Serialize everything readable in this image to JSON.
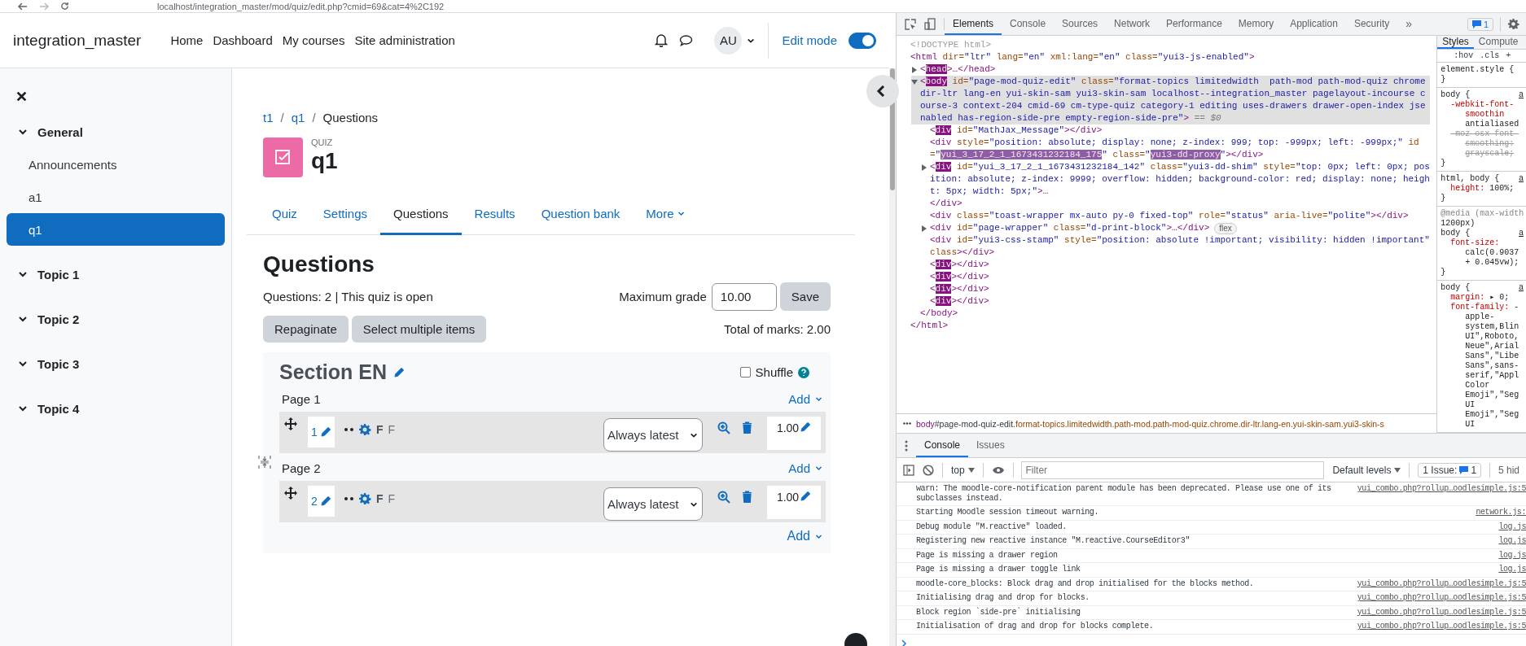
{
  "browser": {
    "url": "localhost/integration_master/mod/quiz/edit.php?cmid=69&cat=4%2C192"
  },
  "header": {
    "site_name": "integration_master",
    "nav": [
      "Home",
      "Dashboard",
      "My courses",
      "Site administration"
    ],
    "avatar": "AU",
    "edit_mode": {
      "label": "Edit mode",
      "on": true
    }
  },
  "drawer": {
    "sections": [
      {
        "title": "General",
        "expanded": true,
        "items": [
          {
            "label": "Announcements",
            "selected": false
          },
          {
            "label": "a1",
            "selected": false
          },
          {
            "label": "q1",
            "selected": true
          }
        ]
      },
      {
        "title": "Topic 1",
        "expanded": true
      },
      {
        "title": "Topic 2",
        "expanded": true
      },
      {
        "title": "Topic 3",
        "expanded": true
      },
      {
        "title": "Topic 4",
        "expanded": true
      }
    ]
  },
  "breadcrumb": [
    {
      "label": "t1",
      "kind": "link"
    },
    {
      "separator": "/",
      "label": "q1",
      "kind": "link"
    },
    {
      "separator": "/",
      "label": "Questions",
      "kind": "current"
    }
  ],
  "activity": {
    "type": "QUIZ",
    "name": "q1"
  },
  "tabs": [
    {
      "label": "Quiz",
      "selected": false,
      "kind": "link"
    },
    {
      "label": "Settings",
      "selected": false,
      "kind": "link"
    },
    {
      "label": "Questions",
      "selected": true,
      "kind": "link"
    },
    {
      "label": "Results",
      "selected": false,
      "kind": "link"
    },
    {
      "label": "Question bank",
      "selected": false,
      "kind": "link"
    },
    {
      "label": "More",
      "selected": false,
      "kind": "dropdown"
    }
  ],
  "page_title": "Questions",
  "quiz_info": "Questions: 2 | This quiz is open",
  "max_grade": {
    "label": "Maximum grade",
    "value": "10.00",
    "button": "Save"
  },
  "actions": [
    "Repaginate",
    "Select multiple items"
  ],
  "total_marks": "Total of marks: 2.00",
  "section": {
    "title": "Section EN",
    "shuffle": {
      "label": "Shuffle",
      "checked": false
    },
    "pages": [
      {
        "title": "Page 1",
        "add": "Add",
        "slots": [
          {
            "number": "1",
            "type_label": "F",
            "name": "F",
            "version": "Always latest",
            "mark": "1.00"
          }
        ]
      },
      {
        "title": "Page 2",
        "add": "Add",
        "slots": [
          {
            "number": "2",
            "type_label": "F",
            "name": "F",
            "version": "Always latest",
            "mark": "1.00"
          }
        ]
      }
    ],
    "add": "Add"
  },
  "devtools": {
    "tabs": [
      {
        "label": "Elements",
        "selected": true
      },
      {
        "label": "Console",
        "selected": false
      },
      {
        "label": "Sources",
        "selected": false
      },
      {
        "label": "Network",
        "selected": false
      },
      {
        "label": "Performance",
        "selected": false
      },
      {
        "label": "Memory",
        "selected": false
      },
      {
        "label": "Application",
        "selected": false
      },
      {
        "label": "Security",
        "selected": false
      }
    ],
    "more_tabs": "»",
    "issues_badge": "1",
    "elements": [
      {
        "open": [
          {
            "kind": "comment",
            "text": "<!DOCTYPE html>"
          }
        ]
      },
      {
        "open": [
          {
            "kind": "tag",
            "text": "<html"
          },
          {
            "kind": "attr",
            "text": " dir="
          },
          {
            "kind": "value",
            "text": "\"ltr\""
          },
          {
            "kind": "attr",
            "text": " lang="
          },
          {
            "kind": "value",
            "text": "\"en\""
          },
          {
            "kind": "attr",
            "text": " xml:lang="
          },
          {
            "kind": "value",
            "text": "\"en\""
          },
          {
            "kind": "attr",
            "text": " class="
          },
          {
            "kind": "value",
            "text": "\"yui3-js-enabled\""
          },
          {
            "kind": "tag",
            "text": ">"
          }
        ],
        "children": [
          {
            "open": [
              {
                "kind": "tag",
                "text": "<"
              },
              {
                "kind": "hl_tag",
                "text": "head"
              },
              {
                "kind": "tag",
                "text": ">…</head>"
              }
            ],
            "expanded": false
          },
          {
            "open": [
              {
                "kind": "tag",
                "text": "<"
              },
              {
                "kind": "hl_tag",
                "text": "body"
              },
              {
                "kind": "attr",
                "text": " id="
              },
              {
                "kind": "value",
                "text": "\"page-mod-quiz-edit\""
              },
              {
                "kind": "attr",
                "text": " class="
              },
              {
                "kind": "value",
                "text": "\"format-topics limitedwidth  path-mod path-mod-quiz chrome dir-ltr lang-en yui-skin-sam yui3-skin-sam localhost--integration_master pagelayout-incourse course-3 context-204 cmid-69 cm-type-quiz category-1 editing uses-drawers drawer-open-index jsenabled has-region-side-pre empty-region-side-pre\""
              },
              {
                "kind": "tag",
                "text": ">"
              },
              {
                "kind": "hint",
                "text": " == $0"
              }
            ],
            "expanded": true,
            "selected": true,
            "children": [
              {
                "open": [
                  {
                    "kind": "tag",
                    "text": "<"
                  },
                  {
                    "kind": "hl_tag",
                    "text": "div"
                  },
                  {
                    "kind": "attr",
                    "text": " id="
                  },
                  {
                    "kind": "value",
                    "text": "\"MathJax_Message\""
                  },
                  {
                    "kind": "tag",
                    "text": "></div>"
                  }
                ]
              },
              {
                "open": [
                  {
                    "kind": "tag",
                    "text": "<div"
                  },
                  {
                    "kind": "attr",
                    "text": " style="
                  },
                  {
                    "kind": "value",
                    "text": "\"position: absolute; display: none; z-index: 999; top: -999px; left: -999px;\""
                  },
                  {
                    "kind": "attr",
                    "text": " id="
                  },
                  {
                    "kind": "value",
                    "text": "\""
                  },
                  {
                    "kind": "hl_value",
                    "text": "yui_3_17_2_1_1673431232184_175"
                  },
                  {
                    "kind": "value",
                    "text": "\""
                  },
                  {
                    "kind": "attr",
                    "text": " class="
                  },
                  {
                    "kind": "value",
                    "text": "\""
                  },
                  {
                    "kind": "hl_value",
                    "text": "yui3-dd-proxy"
                  },
                  {
                    "kind": "value",
                    "text": "\""
                  },
                  {
                    "kind": "tag",
                    "text": "></div>"
                  }
                ]
              },
              {
                "open": [
                  {
                    "kind": "tag",
                    "text": "<"
                  },
                  {
                    "kind": "hl_tag",
                    "text": "div"
                  },
                  {
                    "kind": "attr",
                    "text": " id="
                  },
                  {
                    "kind": "value",
                    "text": "\"yui_3_17_2_1_1673431232184_142\""
                  },
                  {
                    "kind": "attr",
                    "text": " class="
                  },
                  {
                    "kind": "value",
                    "text": "\"yui3-dd-shim\""
                  },
                  {
                    "kind": "attr",
                    "text": " style="
                  },
                  {
                    "kind": "value",
                    "text": "\"top: 0px; left: 0px; position: absolute; z-index: 9999; overflow: hidden; background-color: red; display: none; height: 5px; width: 5px;\""
                  },
                  {
                    "kind": "tag",
                    "text": ">…"
                  }
                ],
                "expanded": false,
                "close": [
                  {
                    "kind": "tag",
                    "text": "</div>"
                  }
                ]
              },
              {
                "open": [
                  {
                    "kind": "tag",
                    "text": "<div"
                  },
                  {
                    "kind": "attr",
                    "text": " class="
                  },
                  {
                    "kind": "value",
                    "text": "\"toast-wrapper mx-auto py-0 fixed-top\""
                  },
                  {
                    "kind": "attr",
                    "text": " role="
                  },
                  {
                    "kind": "value",
                    "text": "\"status\""
                  },
                  {
                    "kind": "attr",
                    "text": " aria-live="
                  },
                  {
                    "kind": "value",
                    "text": "\"polite\""
                  },
                  {
                    "kind": "tag",
                    "text": "></div>"
                  }
                ]
              },
              {
                "open": [
                  {
                    "kind": "tag",
                    "text": "<div"
                  },
                  {
                    "kind": "attr",
                    "text": " id="
                  },
                  {
                    "kind": "value",
                    "text": "\"page-wrapper\""
                  },
                  {
                    "kind": "attr",
                    "text": " class="
                  },
                  {
                    "kind": "value",
                    "text": "\"d-print-block\""
                  },
                  {
                    "kind": "tag",
                    "text": ">…</div>"
                  }
                ],
                "expanded": false,
                "badge": "flex"
              },
              {
                "open": [
                  {
                    "kind": "tag",
                    "text": "<div"
                  },
                  {
                    "kind": "attr",
                    "text": " id="
                  },
                  {
                    "kind": "value",
                    "text": "\"yui3-css-stamp\""
                  },
                  {
                    "kind": "attr",
                    "text": " style="
                  },
                  {
                    "kind": "value",
                    "text": "\"position: absolute !important; visibility: hidden !important\""
                  },
                  {
                    "kind": "attr",
                    "text": " class"
                  },
                  {
                    "kind": "tag",
                    "text": "></div>"
                  }
                ]
              },
              {
                "open": [
                  {
                    "kind": "tag",
                    "text": "<"
                  },
                  {
                    "kind": "hl_tag",
                    "text": "div"
                  },
                  {
                    "kind": "tag",
                    "text": "></div>"
                  }
                ]
              },
              {
                "open": [
                  {
                    "kind": "tag",
                    "text": "<"
                  },
                  {
                    "kind": "hl_tag",
                    "text": "div"
                  },
                  {
                    "kind": "tag",
                    "text": "></div>"
                  }
                ]
              },
              {
                "open": [
                  {
                    "kind": "tag",
                    "text": "<"
                  },
                  {
                    "kind": "hl_tag",
                    "text": "div"
                  },
                  {
                    "kind": "tag",
                    "text": "></div>"
                  }
                ]
              },
              {
                "open": [
                  {
                    "kind": "tag",
                    "text": "<"
                  },
                  {
                    "kind": "hl_tag",
                    "text": "div"
                  },
                  {
                    "kind": "tag",
                    "text": "></div>"
                  }
                ]
              }
            ],
            "close": [
              {
                "kind": "tag",
                "text": "</body>"
              }
            ]
          }
        ],
        "close": [
          {
            "kind": "tag",
            "text": "</html>"
          }
        ]
      }
    ],
    "crumb": [
      {
        "kind": "tag",
        "text": "body"
      },
      {
        "kind": "id",
        "text": "#page-mod-quiz-edit"
      },
      {
        "kind": "cls",
        "text": ".format-topics.limitedwidth.path-mod.path-mod-quiz.chrome.dir-ltr.lang-en.yui-skin-sam.yui3-skin-s"
      }
    ],
    "styles": {
      "tabs": [
        {
          "label": "Styles",
          "selected": true
        },
        {
          "label": "Compute",
          "selected": false
        }
      ],
      "filter_buttons": [
        ":hov",
        ".cls",
        "+"
      ],
      "rules": [
        {
          "lines": [
            {
              "kind": "selector",
              "text": "element.style {"
            },
            {
              "kind": "brace",
              "text": "}"
            }
          ]
        },
        {
          "source": "a",
          "lines": [
            {
              "kind": "selector",
              "text": "body {"
            },
            {
              "kind": "prop",
              "text": "-webkit-font-"
            },
            {
              "kind": "prop_cont",
              "text": "smoothin"
            },
            {
              "kind": "value_cont",
              "text": "antialiased"
            },
            {
              "kind": "struck",
              "text": "-moz-osx-font-"
            },
            {
              "kind": "struck_cont",
              "text": "smoothing:"
            },
            {
              "kind": "struck_cont",
              "text": "grayscale;"
            },
            {
              "kind": "brace",
              "text": "}"
            }
          ]
        },
        {
          "source": "a",
          "lines": [
            {
              "kind": "selector",
              "text": "html, body {"
            },
            {
              "kind": "decl",
              "prop": "height:",
              "text": "100%;"
            },
            {
              "kind": "brace",
              "text": "}"
            }
          ]
        },
        {
          "source": "a",
          "lines": [
            {
              "kind": "media",
              "text": "@media (max-width"
            },
            {
              "kind": "plain",
              "text": "1200px)"
            },
            {
              "kind": "selector",
              "text": "body {"
            },
            {
              "kind": "prop",
              "text": "font-size:"
            },
            {
              "kind": "value_cont",
              "text": "calc(0.9037"
            },
            {
              "kind": "value_cont",
              "text": "+ 0.045vw);"
            },
            {
              "kind": "brace",
              "text": "}"
            }
          ]
        },
        {
          "source": "a",
          "lines": [
            {
              "kind": "selector",
              "text": "body {"
            },
            {
              "kind": "decl",
              "prop": "margin:",
              "text": "▸ 0;"
            },
            {
              "kind": "decl",
              "prop": "font-family:",
              "text": "-"
            },
            {
              "kind": "value_cont",
              "text": "apple-"
            },
            {
              "kind": "value_cont",
              "text": "system,Blin"
            },
            {
              "kind": "value_cont",
              "text": "UI\",Roboto,"
            },
            {
              "kind": "value_cont",
              "text": "Neue\",Arial"
            },
            {
              "kind": "value_cont",
              "text": "Sans\",\"Libe"
            },
            {
              "kind": "value_cont",
              "text": "Sans\",sans-"
            },
            {
              "kind": "value_cont",
              "text": "serif,\"Appl"
            },
            {
              "kind": "value_cont",
              "text": "Color"
            },
            {
              "kind": "value_cont",
              "text": "Emoji\",\"Seg"
            },
            {
              "kind": "value_cont",
              "text": "UI"
            },
            {
              "kind": "value_cont",
              "text": "Emoji\",\"Seg"
            },
            {
              "kind": "value_cont",
              "text": "UI"
            }
          ]
        }
      ]
    },
    "console": {
      "tabs": [
        {
          "label": "Console",
          "selected": true
        },
        {
          "label": "Issues",
          "selected": false
        }
      ],
      "context": "top",
      "filter_placeholder": "Filter",
      "levels": "Default levels",
      "issues_label": "1 Issue:",
      "issues_count": "1",
      "hidden": "5 hid",
      "messages": [
        {
          "text": "warn: The moodle-core-notification parent module has been deprecated. Please use one of its subclasses instead.",
          "source": "yui_combo.php?rollup…oodlesimple.js:5"
        },
        {
          "text": "Starting Moodle session timeout warning.",
          "source": "network.js:"
        },
        {
          "text": "Debug module \"M.reactive\" loaded.",
          "source": "log.js"
        },
        {
          "text": "Registering new reactive instance \"M.reactive.CourseEditor3\"",
          "source": "log.js"
        },
        {
          "text": "Page is missing a drawer region",
          "source": "log.js"
        },
        {
          "text": "Page is missing a drawer toggle link",
          "source": "log.js"
        },
        {
          "text": "moodle-core_blocks: Block drag and drop initialised for the blocks method.",
          "source": "yui_combo.php?rollup…oodlesimple.js:5"
        },
        {
          "text": "Initialising drag and drop for blocks.",
          "source": "yui_combo.php?rollup…oodlesimple.js:5"
        },
        {
          "text": "Block region `side-pre` initialising",
          "source": "yui_combo.php?rollup…oodlesimple.js:5"
        },
        {
          "text": "Initialisation of drag and drop for blocks complete.",
          "source": "yui_combo.php?rollup…oodlesimple.js:5"
        }
      ]
    }
  }
}
